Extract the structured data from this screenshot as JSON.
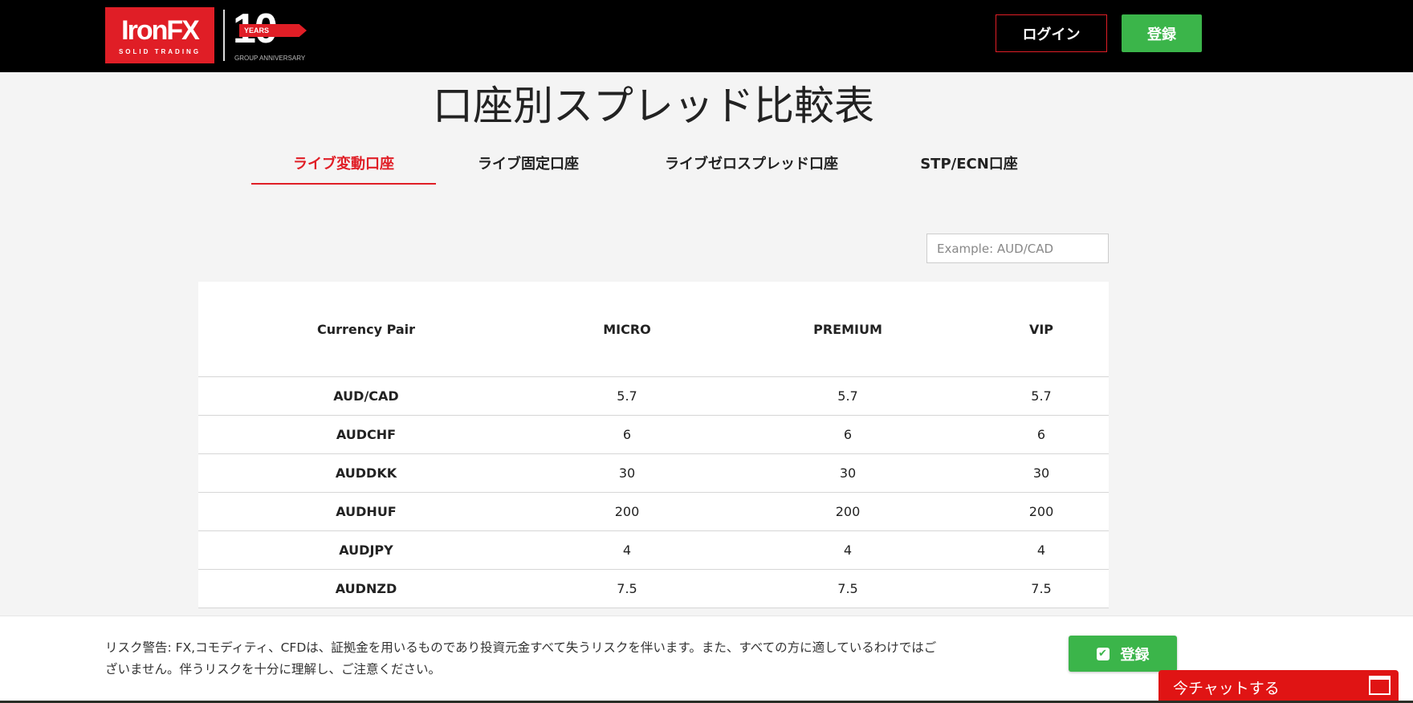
{
  "header": {
    "logo_text": "IronFX",
    "logo_tagline": "SOLID TRADING",
    "anniversary_number": "10",
    "anniversary_years": "YEARS",
    "anniversary_sub": "GROUP ANNIVERSARY",
    "login_label": "ログイン",
    "register_label": "登録"
  },
  "page": {
    "title": "口座別スプレッド比較表"
  },
  "tabs": [
    {
      "label": "ライブ変動口座",
      "active": true
    },
    {
      "label": "ライブ固定口座"
    },
    {
      "label": "ライブゼロスプレッド口座"
    },
    {
      "label": "STP/ECN口座"
    }
  ],
  "search": {
    "placeholder": "Example: AUD/CAD",
    "value": ""
  },
  "table": {
    "headers": [
      "Currency Pair",
      "MICRO",
      "PREMIUM",
      "VIP"
    ],
    "rows": [
      [
        "AUD/CAD",
        "5.7",
        "5.7",
        "5.7"
      ],
      [
        "AUDCHF",
        "6",
        "6",
        "6"
      ],
      [
        "AUDDKK",
        "30",
        "30",
        "30"
      ],
      [
        "AUDHUF",
        "200",
        "200",
        "200"
      ],
      [
        "AUDJPY",
        "4",
        "4",
        "4"
      ],
      [
        "AUDNZD",
        "7.5",
        "7.5",
        "7.5"
      ]
    ]
  },
  "footer": {
    "risk_line1": "リスク警告: FX,コモディティ、CFDは、証拠金を用いるものであり投資元金すべて失うリスクを伴います。また、すべての方に適しているわけではご",
    "risk_line2": "ざいません。伴うリスクを十分に理解し、ご注意ください。",
    "register_label": "登録",
    "chat_label": "今チャットする"
  },
  "colors": {
    "brand_red": "#e01e26",
    "green": "#3bb54a",
    "chat_red": "#e01414"
  }
}
